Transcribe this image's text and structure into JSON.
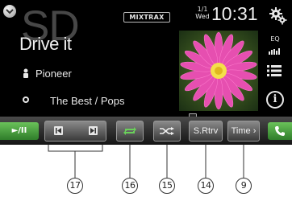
{
  "status_bar": {
    "mixtrax_label": "MIXTRAX",
    "date_top": "1/1",
    "date_bottom": "Wed",
    "time": "10:31",
    "icons": [
      "chevron-down-icon",
      "settings-gears-icon"
    ]
  },
  "now_playing": {
    "source": "SD",
    "title": "Drive it",
    "artist": "Pioneer",
    "album": "The Best / Pops"
  },
  "side_controls": {
    "eq_label": "EQ"
  },
  "control_bar": {
    "play_pause_label": "►/II",
    "srtrv_label": "S.Rtrv",
    "time_label": "Time ›",
    "icons": [
      "skip-back-icon",
      "skip-forward-icon",
      "repeat-icon",
      "shuffle-icon",
      "phone-icon"
    ]
  },
  "callouts": [
    "17",
    "16",
    "15",
    "14",
    "9"
  ],
  "colors": {
    "screen_bg": "#000000",
    "accent_green": "#4fa845",
    "button_gray": "#5a5a5a"
  }
}
